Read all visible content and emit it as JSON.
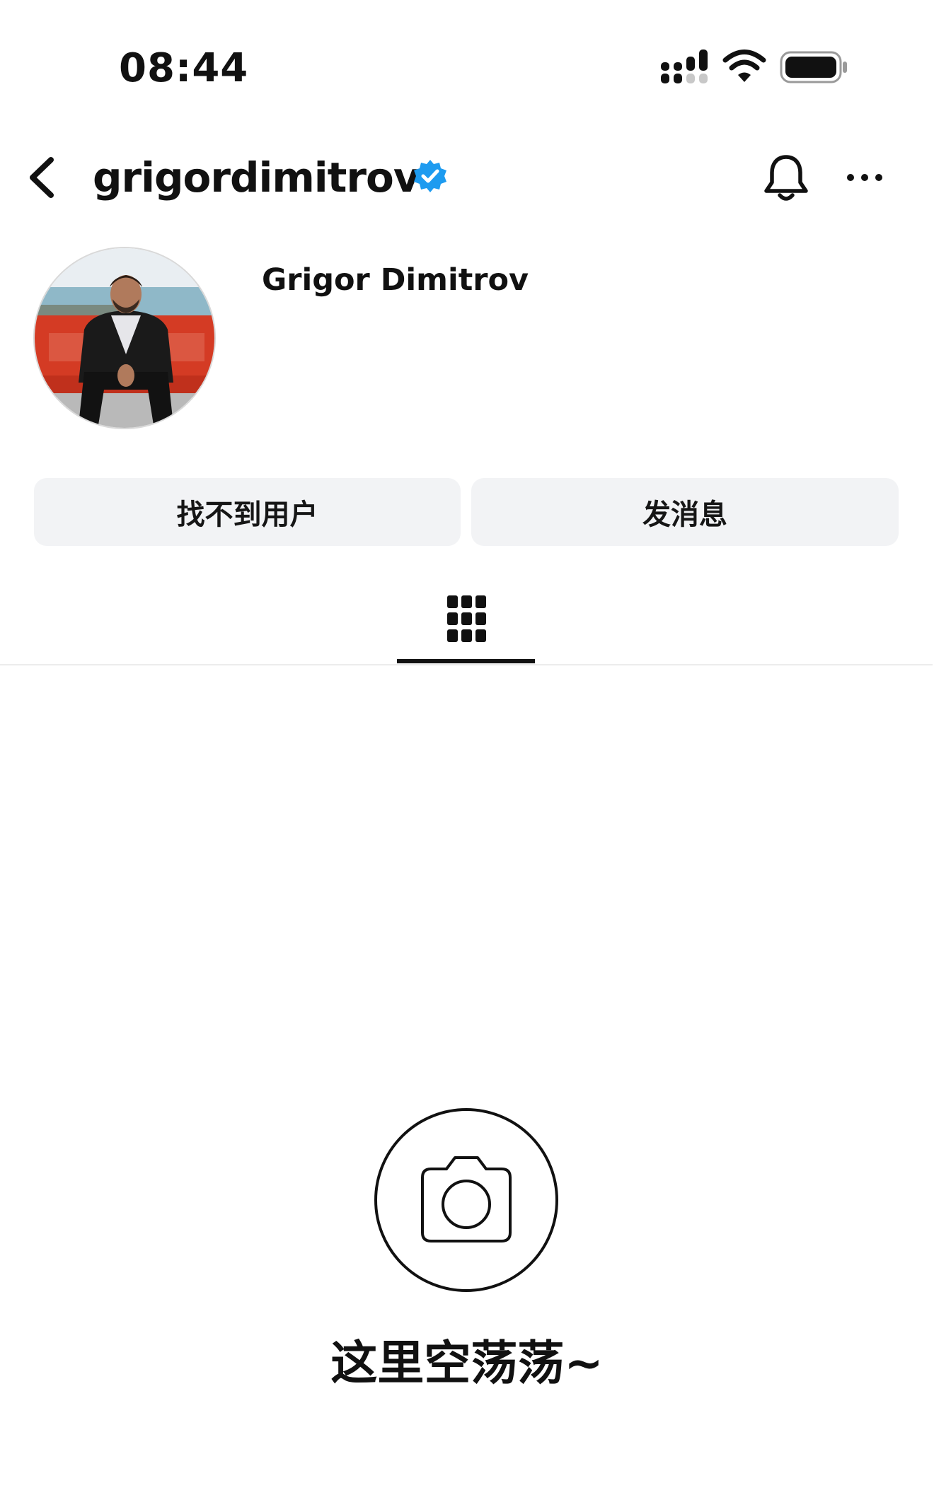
{
  "status_bar": {
    "time": "08:44",
    "icons": [
      "signal-icon",
      "wifi-icon",
      "battery-icon"
    ]
  },
  "nav": {
    "username": "grigordimitrov",
    "verified": true,
    "icons": [
      "back-icon",
      "verified-icon",
      "bell-icon",
      "more-icon"
    ]
  },
  "profile": {
    "display_name": "Grigor Dimitrov"
  },
  "actions": {
    "left_button": "找不到用户",
    "right_button": "发消息"
  },
  "tabs": {
    "active": "grid-icon"
  },
  "empty_state": {
    "icon": "camera-icon",
    "text": "这里空荡荡~"
  },
  "colors": {
    "verified_badge": "#1d9bf0",
    "button_bg": "#f2f3f5",
    "text": "#111111"
  }
}
